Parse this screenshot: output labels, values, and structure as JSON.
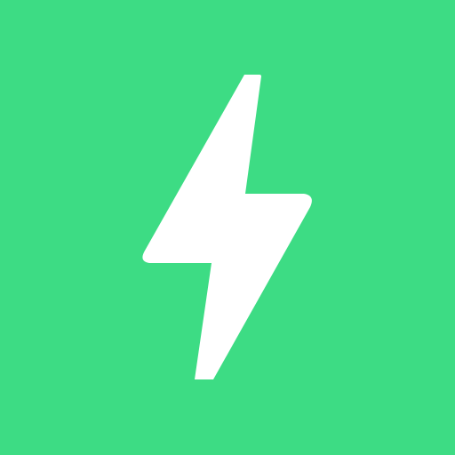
{
  "icon": {
    "name": "lightning-bolt-icon",
    "background_color": "#3ddc84",
    "glyph_color": "#ffffff"
  }
}
